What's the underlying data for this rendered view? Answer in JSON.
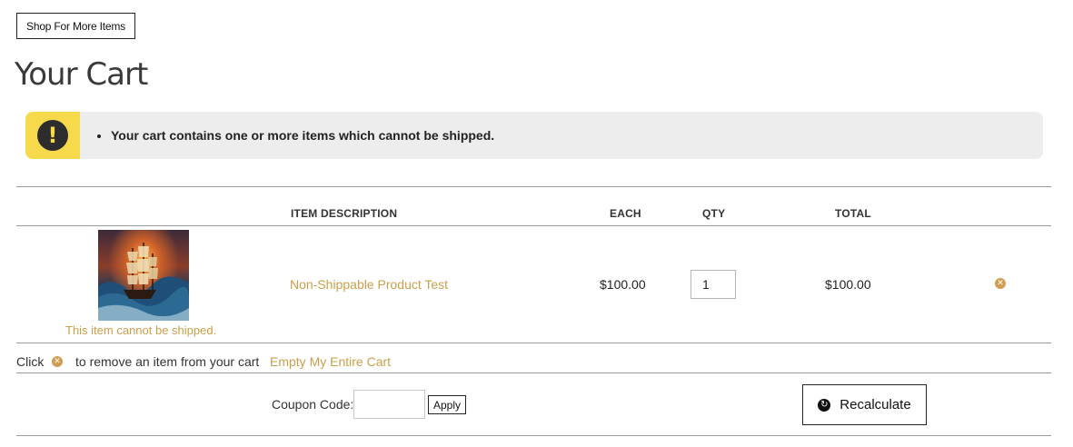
{
  "header": {
    "shop_button_label": "Shop For More Items",
    "title": "Your Cart"
  },
  "alert": {
    "icon_text": "!",
    "icon": "exclamation-icon",
    "message": "Your cart contains one or more items which cannot be shipped."
  },
  "table": {
    "headers": {
      "description": "ITEM DESCRIPTION",
      "each": "EACH",
      "qty": "QTY",
      "total": "TOTAL"
    },
    "items": [
      {
        "name": "Non-Shippable Product Test",
        "note": "This item cannot be shipped.",
        "each": "$100.00",
        "qty": "1",
        "total": "$100.00",
        "thumbnail": "ship-in-storm-image"
      }
    ]
  },
  "remove_help": {
    "prefix": "Click",
    "suffix": "to remove an item from your cart",
    "empty_cart_label": "Empty My Entire Cart",
    "icon_text": "✕"
  },
  "coupon": {
    "label": "Coupon Code:",
    "value": "",
    "apply_label": "Apply"
  },
  "recalculate": {
    "label": "Recalculate",
    "icon_text": "↻"
  },
  "colors": {
    "link": "#c9a04a",
    "alert_bg": "#ededed",
    "alert_icon_bg": "#f7d94c",
    "remove_icon": "#cf9e52"
  }
}
